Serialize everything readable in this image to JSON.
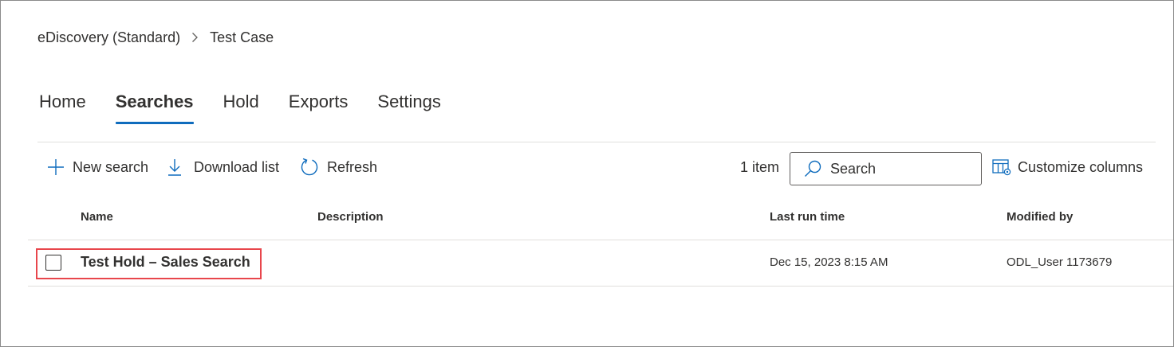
{
  "breadcrumb": {
    "root": "eDiscovery (Standard)",
    "current": "Test Case"
  },
  "tabs": [
    {
      "label": "Home",
      "active": false
    },
    {
      "label": "Searches",
      "active": true
    },
    {
      "label": "Hold",
      "active": false
    },
    {
      "label": "Exports",
      "active": false
    },
    {
      "label": "Settings",
      "active": false
    }
  ],
  "commands": {
    "new_search": "New search",
    "download_list": "Download list",
    "refresh": "Refresh",
    "item_count": "1 item",
    "search_placeholder": "Search",
    "customize_columns": "Customize columns"
  },
  "table": {
    "columns": [
      "Name",
      "Description",
      "Last run time",
      "Modified by"
    ],
    "rows": [
      {
        "name": "Test Hold – Sales Search",
        "description": "",
        "last_run_time": "Dec 15, 2023 8:15 AM",
        "modified_by": "ODL_User 1173679",
        "selected": false
      }
    ]
  },
  "icons": {
    "breadcrumb_separator": "chevron-right-icon",
    "new_search": "plus-icon",
    "download_list": "download-icon",
    "refresh": "refresh-icon",
    "search": "search-icon",
    "customize_columns": "table-columns-icon"
  },
  "colors": {
    "accent": "#0f6cbd",
    "highlight": "#e8464c",
    "text": "#323130",
    "divider": "#e1dfdd"
  }
}
